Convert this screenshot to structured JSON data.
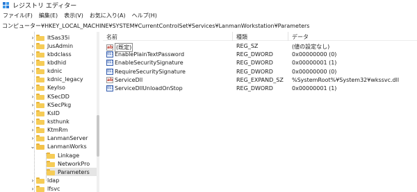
{
  "window": {
    "title": "レジストリ エディター"
  },
  "menu": [
    "ファイル(F)",
    "編集(E)",
    "表示(V)",
    "お気に入り(A)",
    "ヘルプ(H)"
  ],
  "address": "コンピューター¥HKEY_LOCAL_MACHINE¥SYSTEM¥CurrentControlSet¥Services¥LanmanWorkstation¥Parameters",
  "tree": [
    {
      "label": "ItSas35i",
      "expander": "chevron-right"
    },
    {
      "label": "JusAdmin",
      "expander": "chevron-right"
    },
    {
      "label": "kbdclass",
      "expander": "chevron-right"
    },
    {
      "label": "kbdhid",
      "expander": "chevron-right"
    },
    {
      "label": "kdnic",
      "expander": "chevron-right"
    },
    {
      "label": "kdnic_legacy",
      "expander": "none"
    },
    {
      "label": "KeyIso",
      "expander": "chevron-right"
    },
    {
      "label": "KSecDD",
      "expander": "chevron-right"
    },
    {
      "label": "KSecPkg",
      "expander": "chevron-right"
    },
    {
      "label": "KsID",
      "expander": "chevron-right"
    },
    {
      "label": "ksthunk",
      "expander": "chevron-right"
    },
    {
      "label": "KtmRm",
      "expander": "chevron-right"
    },
    {
      "label": "LanmanServer",
      "expander": "chevron-right"
    },
    {
      "label": "LanmanWorks",
      "expander": "chevron-down"
    },
    {
      "label": "Linkage",
      "expander": "none",
      "child": true
    },
    {
      "label": "NetworkPro",
      "expander": "none",
      "child": true
    },
    {
      "label": "Parameters",
      "expander": "none",
      "child": true,
      "selected": true
    },
    {
      "label": "ldap",
      "expander": "chevron-right"
    },
    {
      "label": "lfsvc",
      "expander": "chevron-right"
    }
  ],
  "columns": {
    "name": "名前",
    "type": "種類",
    "data": "データ"
  },
  "values": [
    {
      "icon": "string-value-icon",
      "name": "(既定)",
      "type": "REG_SZ",
      "data": "(値の設定なし)",
      "is_default": true
    },
    {
      "icon": "binary-value-icon",
      "name": "EnablePlainTextPassword",
      "type": "REG_DWORD",
      "data": "0x00000000 (0)"
    },
    {
      "icon": "binary-value-icon",
      "name": "EnableSecuritySignature",
      "type": "REG_DWORD",
      "data": "0x00000001 (1)"
    },
    {
      "icon": "binary-value-icon",
      "name": "RequireSecuritySignature",
      "type": "REG_DWORD",
      "data": "0x00000000 (0)"
    },
    {
      "icon": "string-value-icon",
      "name": "ServiceDll",
      "type": "REG_EXPAND_SZ",
      "data": "%SystemRoot%¥System32¥wkssvc.dll"
    },
    {
      "icon": "binary-value-icon",
      "name": "ServiceDllUnloadOnStop",
      "type": "REG_DWORD",
      "data": "0x00000001 (1)"
    }
  ],
  "icons": {
    "string": "ab",
    "binary": "011"
  }
}
